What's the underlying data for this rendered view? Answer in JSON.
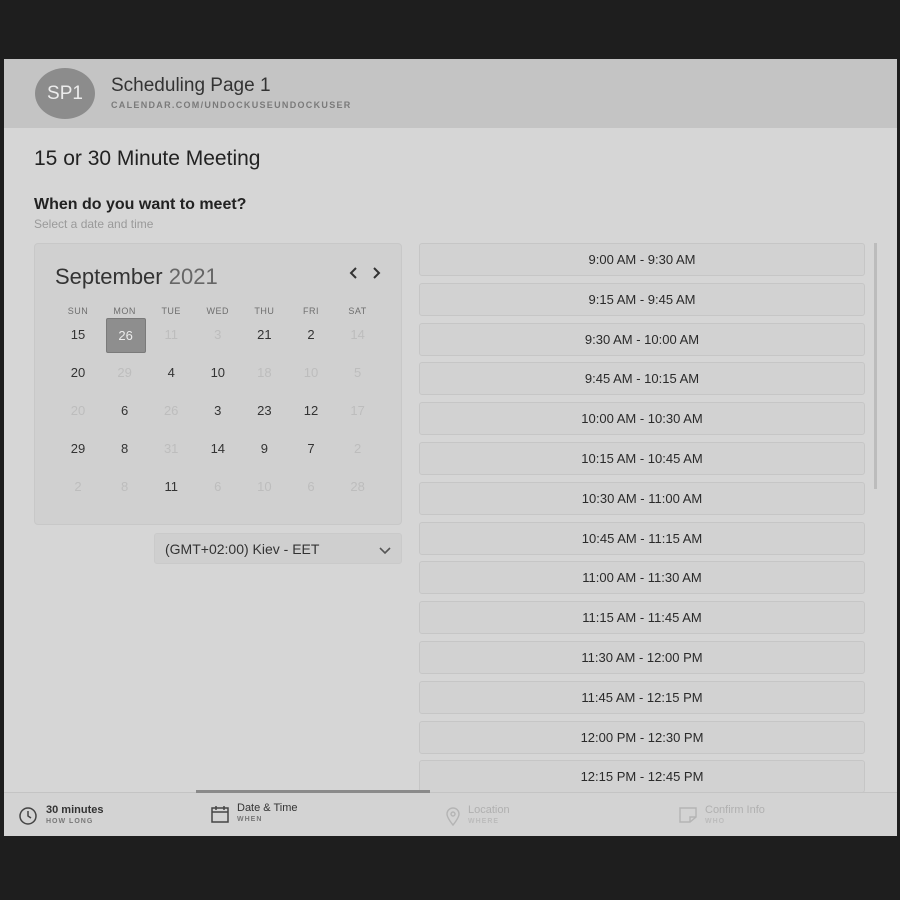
{
  "header": {
    "avatar_initials": "SP1",
    "page_name": "Scheduling Page 1",
    "page_url": "CALENDAR.COM/UNDOCKUSEUNDOCKUSER"
  },
  "meeting": {
    "title": "15 or 30 Minute Meeting",
    "question": "When do you want to meet?",
    "subtitle": "Select a date and time"
  },
  "calendar": {
    "month": "September",
    "year": "2021",
    "prev_icon": "chevron-left-icon",
    "next_icon": "chevron-right-icon",
    "weekdays": [
      "SUN",
      "MON",
      "TUE",
      "WED",
      "THU",
      "FRI",
      "SAT"
    ],
    "weeks": [
      [
        {
          "d": "15",
          "s": "on"
        },
        {
          "d": "26",
          "s": "sel"
        },
        {
          "d": "11",
          "s": "dis"
        },
        {
          "d": "3",
          "s": "dis"
        },
        {
          "d": "21",
          "s": "on"
        },
        {
          "d": "2",
          "s": "on"
        },
        {
          "d": "14",
          "s": "dis"
        }
      ],
      [
        {
          "d": "20",
          "s": "on"
        },
        {
          "d": "29",
          "s": "dis"
        },
        {
          "d": "4",
          "s": "on"
        },
        {
          "d": "10",
          "s": "on"
        },
        {
          "d": "18",
          "s": "dis"
        },
        {
          "d": "10",
          "s": "dis"
        },
        {
          "d": "5",
          "s": "dis"
        }
      ],
      [
        {
          "d": "20",
          "s": "dis"
        },
        {
          "d": "6",
          "s": "on"
        },
        {
          "d": "26",
          "s": "dis"
        },
        {
          "d": "3",
          "s": "on"
        },
        {
          "d": "23",
          "s": "on"
        },
        {
          "d": "12",
          "s": "on"
        },
        {
          "d": "17",
          "s": "dis"
        }
      ],
      [
        {
          "d": "29",
          "s": "on"
        },
        {
          "d": "8",
          "s": "on"
        },
        {
          "d": "31",
          "s": "dis"
        },
        {
          "d": "14",
          "s": "on"
        },
        {
          "d": "9",
          "s": "on"
        },
        {
          "d": "7",
          "s": "on"
        },
        {
          "d": "2",
          "s": "dis"
        }
      ],
      [
        {
          "d": "2",
          "s": "dis"
        },
        {
          "d": "8",
          "s": "dis"
        },
        {
          "d": "11",
          "s": "on"
        },
        {
          "d": "6",
          "s": "dis"
        },
        {
          "d": "10",
          "s": "dis"
        },
        {
          "d": "6",
          "s": "dis"
        },
        {
          "d": "28",
          "s": "dis"
        }
      ]
    ]
  },
  "timezone": {
    "label": "(GMT+02:00) Kiev - EET",
    "icon": "chevron-down-icon"
  },
  "time_slots": [
    "9:00 AM - 9:30 AM",
    "9:15 AM - 9:45 AM",
    "9:30 AM - 10:00 AM",
    "9:45 AM - 10:15 AM",
    "10:00 AM - 10:30 AM",
    "10:15 AM - 10:45 AM",
    "10:30 AM - 11:00 AM",
    "10:45 AM - 11:15 AM",
    "11:00 AM - 11:30 AM",
    "11:15 AM - 11:45 AM",
    "11:30 AM - 12:00 PM",
    "11:45 AM - 12:15 PM",
    "12:00 PM - 12:30 PM",
    "12:15 PM - 12:45 PM"
  ],
  "steps": [
    {
      "label": "30 minutes",
      "sub": "HOW LONG",
      "icon": "clock-icon",
      "state": "done"
    },
    {
      "label": "Date & Time",
      "sub": "WHEN",
      "icon": "calendar-icon",
      "state": "active"
    },
    {
      "label": "Location",
      "sub": "WHERE",
      "icon": "location-pin-icon",
      "state": "faded"
    },
    {
      "label": "Confirm Info",
      "sub": "WHO",
      "icon": "note-icon",
      "state": "faded"
    }
  ],
  "colors": {
    "page_bg": "#1e1e1e",
    "panel_bg": "#d6d6d6",
    "header_bg": "#c4c4c4",
    "selected_day": "#8e8e8e"
  }
}
